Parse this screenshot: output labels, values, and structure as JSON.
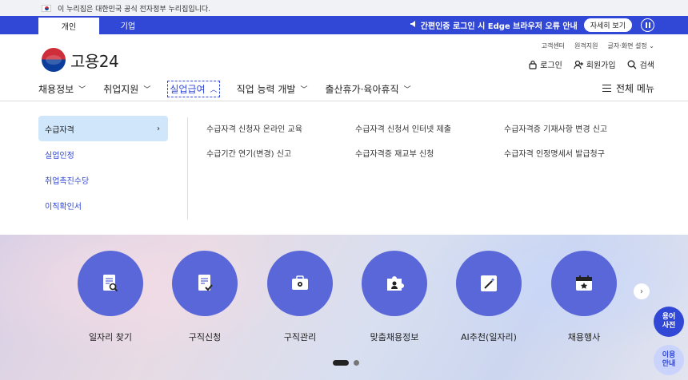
{
  "gov_banner": {
    "text": "이 누리집은 대한민국 공식 전자정부 누리집입니다."
  },
  "tabs": [
    {
      "label": "개인"
    },
    {
      "label": "기업"
    }
  ],
  "notice": {
    "text": "간편인증 로그인 시 Edge 브라우저 오류 안내",
    "detail_label": "자세히 보기"
  },
  "util_links": [
    {
      "label": "고객센터"
    },
    {
      "label": "원격지원"
    },
    {
      "label": "글자·화면 설정"
    }
  ],
  "logo": {
    "text": "고용24"
  },
  "user_links": {
    "login": "로그인",
    "signup": "회원가입",
    "search": "검색"
  },
  "main_nav": [
    {
      "label": "채용정보"
    },
    {
      "label": "취업지원"
    },
    {
      "label": "실업급여"
    },
    {
      "label": "직업 능력 개발"
    },
    {
      "label": "출산휴가·육아휴직"
    }
  ],
  "full_menu_label": "전체 메뉴",
  "side_menu": [
    {
      "label": "수급자격"
    },
    {
      "label": "실업인정"
    },
    {
      "label": "취업촉진수당"
    },
    {
      "label": "이직확인서"
    }
  ],
  "sub_links": [
    {
      "label": "수급자격 신청자 온라인 교육"
    },
    {
      "label": "수급자격 신청서 인터넷 제출"
    },
    {
      "label": "수급자격증 기재사항 변경 신고"
    },
    {
      "label": "수급기간 연기(변경) 신고"
    },
    {
      "label": "수급자격증 재교부 신청"
    },
    {
      "label": "수급자격 인정명세서 발급청구"
    }
  ],
  "quick_menu": [
    {
      "label": "일자리 찾기",
      "icon": "job-search-icon"
    },
    {
      "label": "구직신청",
      "icon": "application-form-icon"
    },
    {
      "label": "구직관리",
      "icon": "briefcase-gear-icon"
    },
    {
      "label": "맞춤채용정보",
      "icon": "puzzle-person-icon"
    },
    {
      "label": "AI추천(일자리)",
      "icon": "magic-wand-icon"
    },
    {
      "label": "채용행사",
      "icon": "calendar-star-icon"
    }
  ],
  "float_buttons": {
    "glossary": "용어\n사전",
    "guide": "이용\n안내"
  },
  "colors": {
    "primary": "#3148d6",
    "quick_circle": "#5a67d8",
    "active_side": "#cfe6fb"
  }
}
